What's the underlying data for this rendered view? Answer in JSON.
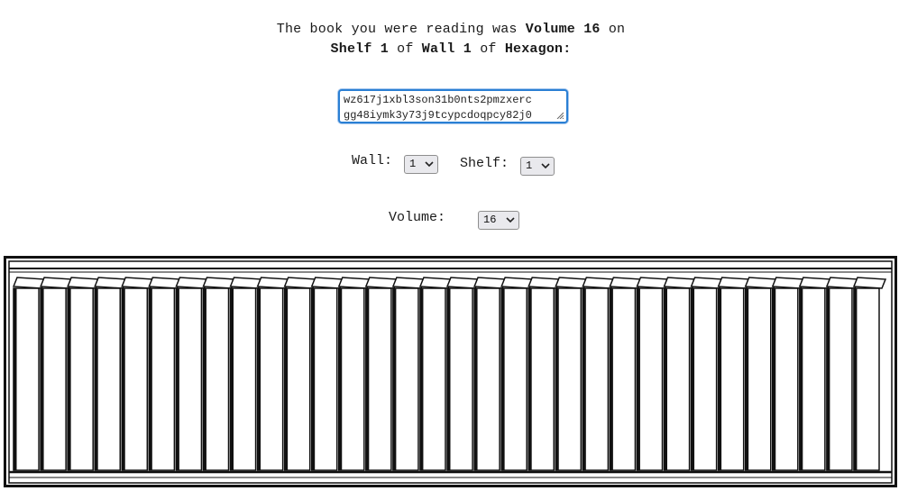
{
  "heading": {
    "line1_prefix": "The book you were reading was",
    "volume_text": "Volume 16",
    "line1_suffix": "on",
    "shelf_text": "Shelf 1",
    "of1": "of",
    "wall_text": "Wall 1",
    "of2": "of",
    "hexagon_text": "Hexagon:"
  },
  "hexagon_input": {
    "line1": "wz617j1xbl3son31b0nts2pmzxerc",
    "line2": "gg48iymk3y73j9tcypcdoqpcy82j0"
  },
  "wall": {
    "label": "Wall:",
    "value": "1"
  },
  "shelf": {
    "label": "Shelf:",
    "value": "1"
  },
  "volume": {
    "label": "Volume:",
    "value": "16"
  },
  "bookshelf": {
    "book_count": 32
  },
  "icons": [
    "chevron-down-icon",
    "resize-grip-icon"
  ]
}
